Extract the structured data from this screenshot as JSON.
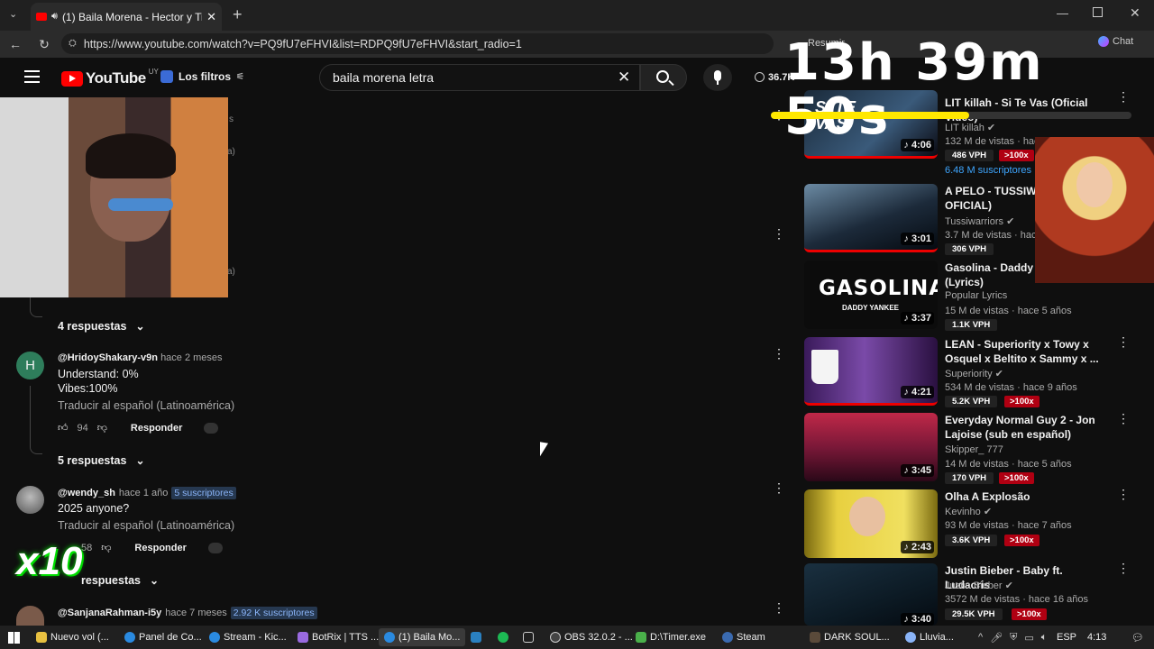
{
  "browser": {
    "tab_title": "(1) Baila Morena - Hector y Tit",
    "url": "https://www.youtube.com/watch?v=PQ9fU7eFHVI&list=RDPQ9fU7eFHVI&start_radio=1",
    "resumir": "Resumir",
    "chat": "Chat"
  },
  "header": {
    "logo": "YouTube",
    "country": "UY",
    "filters": "Los filtros",
    "search_value": "baila morena letra",
    "count": "36.7K"
  },
  "overlay": {
    "timer": "13h 39m 50s",
    "multiplier": "x10"
  },
  "comments": [
    {
      "replies": "4 respuestas"
    },
    {
      "avatar_letter": "H",
      "author": "@HridoyShakary-v9n",
      "time": "hace 2 meses",
      "line1": "Understand: 0%",
      "line2": "Vibes:100%",
      "translate": "Traducir al español (Latinoamérica)",
      "likes": "94",
      "reply": "Responder",
      "replies": "5 respuestas"
    },
    {
      "author": "@wendy_sh",
      "time": "hace 1 año",
      "badge": "5 suscriptores",
      "line1": "2025 anyone?",
      "translate": "Traducir al español (Latinoamérica)",
      "likes": "58",
      "reply": "Responder",
      "replies": "respuestas"
    },
    {
      "author": "@SanjanaRahman-i5y",
      "time": "hace 7 meses",
      "badge": "2.92 K suscriptores"
    }
  ],
  "videos": [
    {
      "title": "LIT killah - Si Te Vas (Oficial Video)",
      "channel": "LIT killah",
      "meta": "132 M de vistas · hace",
      "vph": "486 VPH",
      "x100": ">100x",
      "subs": "6.48 M suscriptores",
      "duration": "4:06",
      "thumb_text": "SI TE VAS"
    },
    {
      "title": "A PELO - TUSSIWA (VIDEO OFICIAL)",
      "channel": "Tussiwarriors",
      "meta": "3.7 M de vistas · hac",
      "vph": "306 VPH",
      "duration": "3:01"
    },
    {
      "title": "Gasolina - Daddy Yankee (Lyrics)",
      "channel": "Popular Lyrics",
      "meta": "15 M de vistas · hace 5 años",
      "vph": "1.1K VPH",
      "duration": "3:37",
      "thumb_text": "GASOLINA",
      "thumb_sub": "DADDY YANKEE"
    },
    {
      "title": "LEAN - Superiority x Towy x Osquel x Beltito x Sammy x ...",
      "channel": "Superiority",
      "meta": "534 M de vistas · hace 9 años",
      "vph": "5.2K VPH",
      "x100": ">100x",
      "duration": "4:21"
    },
    {
      "title": "Everyday Normal Guy 2 - Jon Lajoise (sub en español)",
      "channel": "Skipper_ 777",
      "meta": "14 M de vistas · hace 5 años",
      "vph": "170 VPH",
      "x100": ">100x",
      "duration": "3:45"
    },
    {
      "title": "Olha A Explosão",
      "channel": "Kevinho",
      "meta": "93 M de vistas · hace 7 años",
      "vph": "3.6K VPH",
      "x100": ">100x",
      "duration": "2:43"
    },
    {
      "title": "Justin Bieber - Baby ft. Ludacris",
      "channel": "Justin Bieber",
      "meta": "3572 M de vistas · hace 16 años",
      "vph": "29.5K VPH",
      "x100": ">100x",
      "duration": "3:40"
    }
  ],
  "taskbar": {
    "items": [
      "Nuevo vol (...",
      "Panel de Co...",
      "Stream - Kic...",
      "BotRix | TTS ...",
      "(1) Baila Mo...",
      "OBS 32.0.2 - ...",
      "D:\\Timer.exe",
      "Steam",
      "DARK SOUL...",
      "Lluvia..."
    ],
    "lang": "ESP",
    "time": "4:13"
  }
}
